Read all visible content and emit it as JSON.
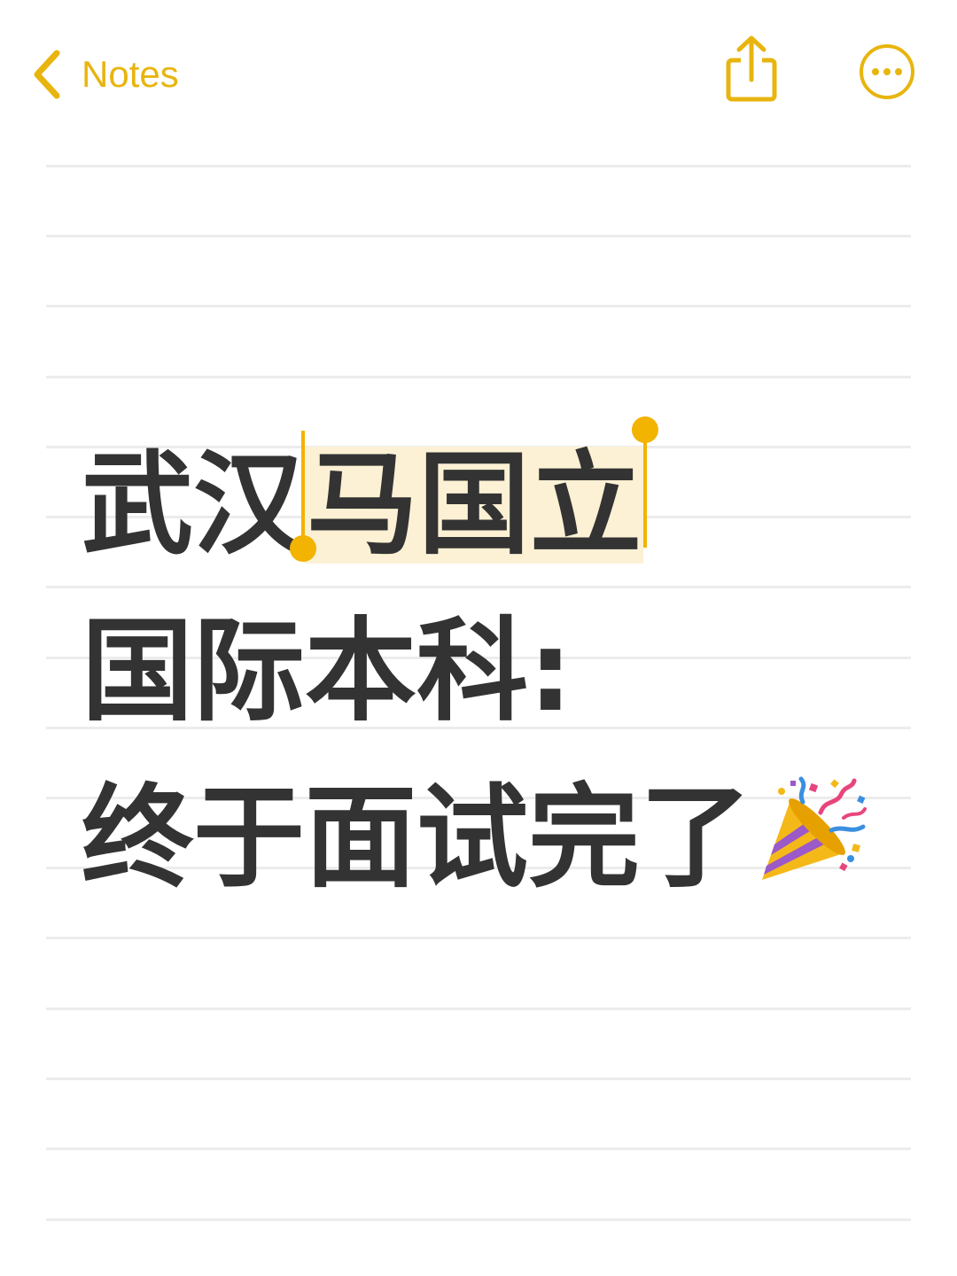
{
  "nav": {
    "back_label": "Notes",
    "back_icon": "chevron-left-icon",
    "share_icon": "share-icon",
    "more_icon": "more-icon"
  },
  "colors": {
    "accent": "#E8B50F",
    "selection": "#FCF1D4",
    "text": "#333333",
    "rule": "#ececec"
  },
  "note": {
    "line1_plain": "武汉",
    "line1_selected": "马国立",
    "line2": "国际本科:",
    "line3": "终于面试完了",
    "line3_emoji": "party-popper-icon"
  }
}
